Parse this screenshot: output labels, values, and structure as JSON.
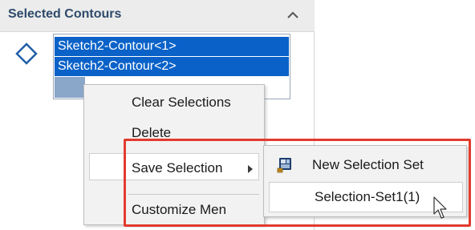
{
  "panel": {
    "title": "Selected Contours",
    "collapse_icon": "chevron-up-icon",
    "contour_icon": "diamond-icon",
    "items": [
      {
        "label": "Sketch2-Contour<1>"
      },
      {
        "label": "Sketch2-Contour<2>"
      }
    ]
  },
  "context_menu": {
    "items": [
      {
        "label": "Clear Selections"
      },
      {
        "label": "Delete"
      },
      {
        "label": "Save Selection",
        "has_submenu": true
      },
      {
        "label": "Customize Men"
      }
    ]
  },
  "submenu": {
    "items": [
      {
        "label": "New Selection Set",
        "icon": "selection-set-icon"
      },
      {
        "label": "Selection-Set1(1)"
      }
    ]
  },
  "colors": {
    "selection_blue": "#0a62c8",
    "highlight_red": "#e23b2e",
    "title_blue": "#2e4a6b"
  }
}
